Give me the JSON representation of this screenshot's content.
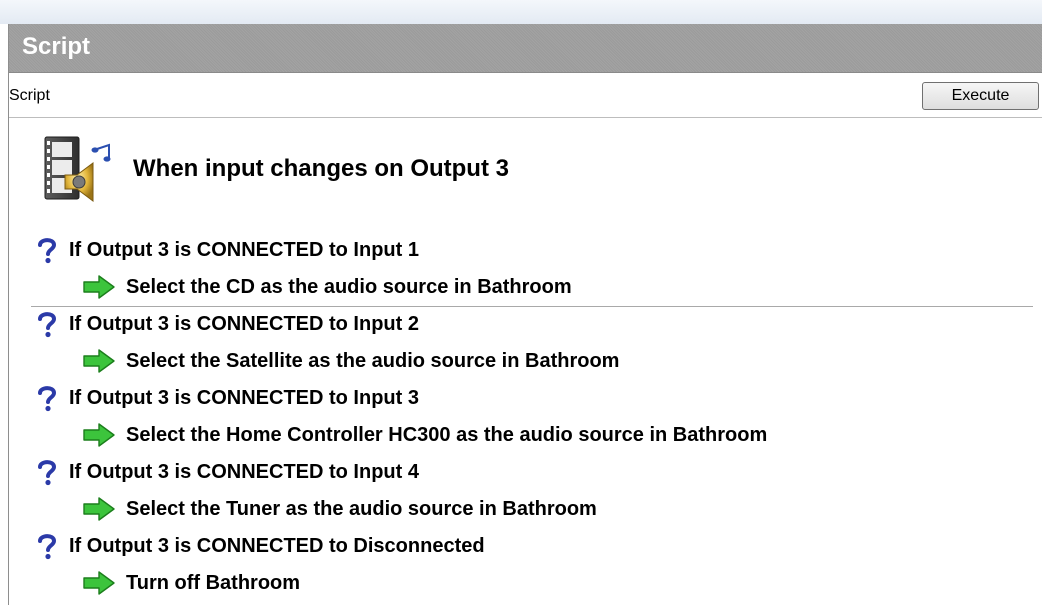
{
  "panel": {
    "title": "Script"
  },
  "toolbar": {
    "label": "Script",
    "execute_label": "Execute"
  },
  "event": {
    "title": "When input changes on Output 3",
    "icon": "audio-media-icon"
  },
  "rules": [
    {
      "condition": "If Output 3 is CONNECTED to Input 1",
      "action": "Select the CD as the audio source in Bathroom"
    },
    {
      "condition": "If Output 3 is CONNECTED to Input 2",
      "action": "Select the Satellite as the audio source in Bathroom"
    },
    {
      "condition": "If Output 3 is CONNECTED to Input 3",
      "action": "Select the Home Controller HC300 as the audio source in Bathroom"
    },
    {
      "condition": "If Output 3 is CONNECTED to Input 4",
      "action": "Select the Tuner as the audio source in Bathroom"
    },
    {
      "condition": "If Output 3 is CONNECTED to Disconnected",
      "action": "Turn off Bathroom"
    }
  ],
  "icons": {
    "condition": "question-mark-icon",
    "action": "green-arrow-icon"
  },
  "colors": {
    "title_bar": "#a0a0a0",
    "condition_icon": "#2b3aa8",
    "action_icon": "#3cc43c"
  }
}
